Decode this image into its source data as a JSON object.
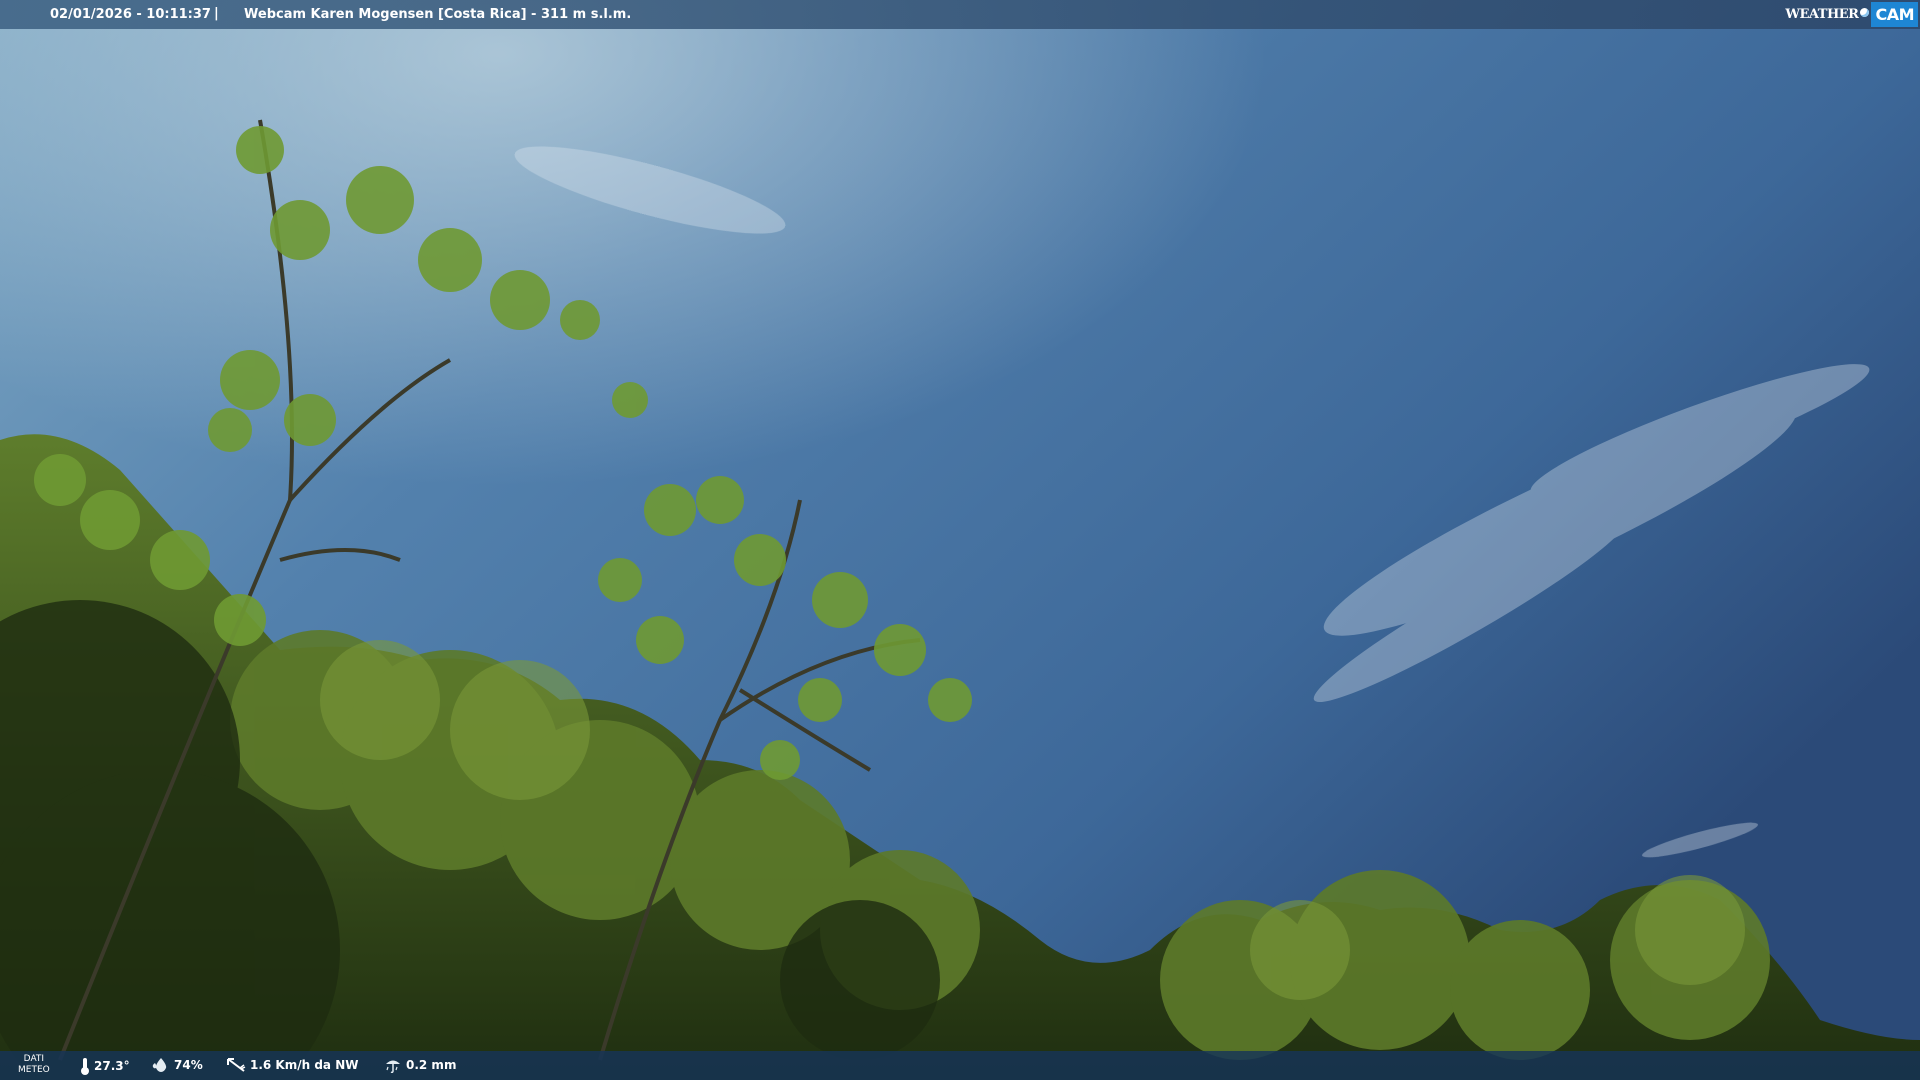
{
  "header": {
    "datetime": "02/01/2026 - 10:11:37",
    "separator": "|",
    "station": "Webcam Karen Mogensen [Costa Rica]  - 311 m s.l.m."
  },
  "logo": {
    "weather": "WEATHER",
    "cam": "CAM"
  },
  "footer": {
    "dati_line1": "DATI",
    "dati_line2": "METEO",
    "temperature": "27.3°",
    "humidity": "74%",
    "wind": "1.6 Km/h da NW",
    "rain": "0.2 mm"
  },
  "icons": {
    "temperature": "thermometer-icon",
    "humidity": "humidity-drop-icon",
    "wind": "wind-vane-icon",
    "rain": "rain-gauge-icon"
  },
  "colors": {
    "sky_top": "#6f9fc2",
    "sky_right": "#2e4f7e",
    "foliage": "#3e5a1e",
    "cam_badge": "#1e86d4"
  }
}
